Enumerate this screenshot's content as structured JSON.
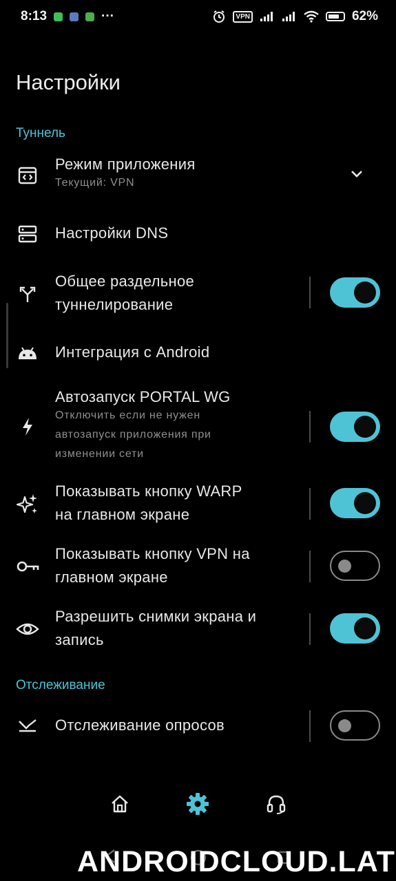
{
  "status_bar": {
    "time": "8:13",
    "more_indicator": "···",
    "vpn_label": "VPN",
    "battery": "62%"
  },
  "page": {
    "title": "Настройки"
  },
  "sections": {
    "tunnel": "Туннель",
    "tracking": "Отслеживание"
  },
  "settings": {
    "app_mode": {
      "title": "Режим приложения",
      "subtitle": "Текущий: VPN",
      "icon": "app-mode-icon"
    },
    "dns": {
      "title": "Настройки DNS",
      "icon": "dns-icon"
    },
    "split_tunnel": {
      "title": "Общее раздельное\nтуннелирование",
      "icon": "split-icon",
      "enabled": true
    },
    "android_integration": {
      "title": "Интеграция с Android",
      "icon": "android-icon"
    },
    "autostart": {
      "title": "Автозапуск PORTAL WG",
      "subtitle": "Отключить если не нужен\nавтозапуск приложения при\nизменении сети",
      "icon": "bolt-icon",
      "enabled": true
    },
    "warp_button": {
      "title": "Показывать кнопку WARP\nна главном экране",
      "icon": "sparkle-icon",
      "enabled": true
    },
    "vpn_button": {
      "title": "Показывать кнопку VPN на\nглавном экране",
      "icon": "key-icon",
      "enabled": false
    },
    "screenshots": {
      "title": "Разрешить снимки экрана и\nзапись",
      "icon": "eye-icon",
      "enabled": true
    },
    "poll_tracking": {
      "title": "Отслеживание опросов",
      "icon": "tracking-icon",
      "enabled": false
    }
  },
  "bottom_nav": {
    "items": [
      "home-icon",
      "settings-gear-icon",
      "support-headset-icon"
    ],
    "active": "settings-gear-icon"
  },
  "watermark": "ANDROIDCLOUD.LAT",
  "colors": {
    "accent": "#4fc3d6",
    "background": "#000000",
    "text": "#e8e8e8",
    "subtext": "#8f8f8f"
  }
}
